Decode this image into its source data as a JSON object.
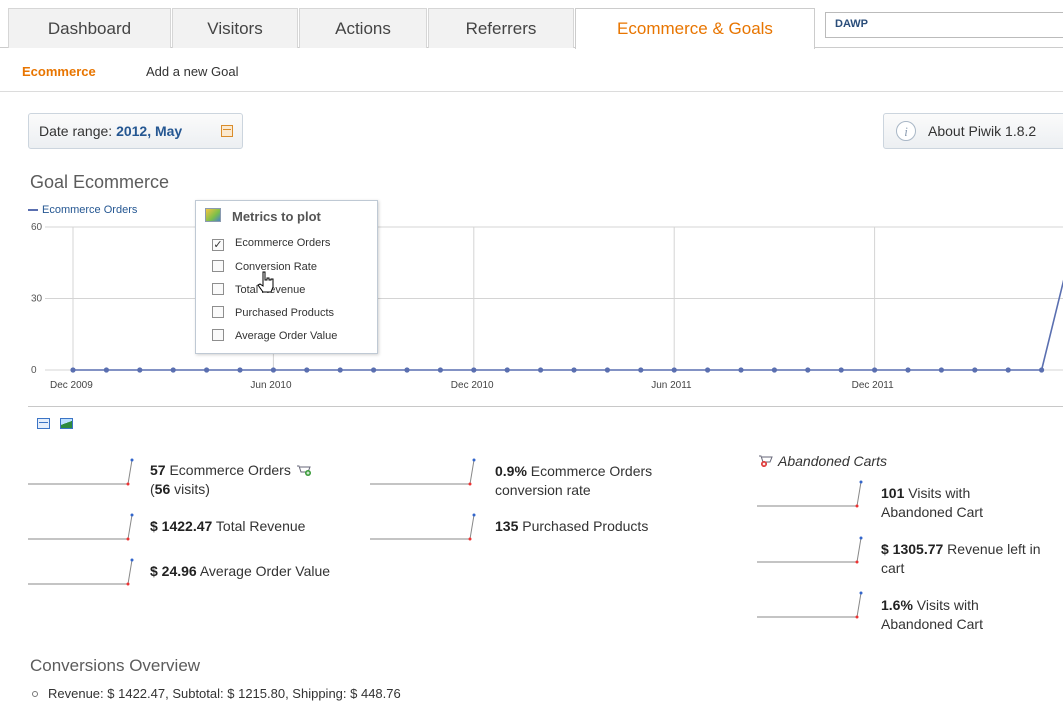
{
  "tabs": [
    {
      "label": "Dashboard"
    },
    {
      "label": "Visitors"
    },
    {
      "label": "Actions"
    },
    {
      "label": "Referrers"
    },
    {
      "label": "Ecommerce & Goals"
    }
  ],
  "site_selector": "DAWP",
  "subnav": {
    "ecommerce": "Ecommerce",
    "add_goal": "Add a new Goal"
  },
  "date_range": {
    "label": "Date range:",
    "value": "2012, May"
  },
  "about": "About Piwik 1.8.2",
  "goal_title": "Goal Ecommerce",
  "chart_data": {
    "type": "line",
    "series": [
      {
        "name": "Ecommerce Orders",
        "values": [
          0,
          0,
          0,
          0,
          0,
          0,
          0,
          0,
          0,
          0,
          0,
          0,
          0,
          0,
          0,
          0,
          0,
          0,
          0,
          0,
          0,
          0,
          0,
          0,
          0,
          0,
          0,
          0,
          0,
          0,
          57
        ]
      }
    ],
    "x_labels": [
      "Dec 2009",
      "Jun 2010",
      "Dec 2010",
      "Jun 2011",
      "Dec 2011"
    ],
    "y_ticks": [
      "0",
      "30",
      "60"
    ],
    "ylim": [
      0,
      60
    ],
    "grid": true,
    "legend": "top-left",
    "color": "#5a6fb0"
  },
  "metrics_popup": {
    "title": "Metrics to plot",
    "options": [
      {
        "label": "Ecommerce Orders",
        "checked": true
      },
      {
        "label": "Conversion Rate",
        "checked": false
      },
      {
        "label": "Total Revenue",
        "checked": false
      },
      {
        "label": "Purchased Products",
        "checked": false
      },
      {
        "label": "Average Order Value",
        "checked": false
      }
    ]
  },
  "metrics": {
    "orders_value": "57",
    "orders_label": " Ecommerce Orders",
    "orders_visits_value": "56",
    "orders_visits_label": " visits)",
    "revenue_value": "$ 1422.47",
    "revenue_label": " Total Revenue",
    "aov_value": "$ 24.96",
    "aov_label": " Average Order Value",
    "conv_rate_value": "0.9%",
    "conv_rate_label1": " Ecommerce Orders",
    "conv_rate_label2": "conversion rate",
    "products_value": "135",
    "products_label": " Purchased Products"
  },
  "abandoned": {
    "title": "Abandoned Carts",
    "visits_value": "101",
    "visits_label1": " Visits with",
    "visits_label2": "Abandoned Cart",
    "revenue_value": "$ 1305.77",
    "revenue_label1": " Revenue left in",
    "revenue_label2": "cart",
    "rate_value": "1.6%",
    "rate_label1": " Visits with",
    "rate_label2": "Abandoned Cart"
  },
  "conversions": {
    "title": "Conversions Overview",
    "item": "Revenue: $ 1422.47, Subtotal: $ 1215.80, Shipping: $ 448.76"
  }
}
